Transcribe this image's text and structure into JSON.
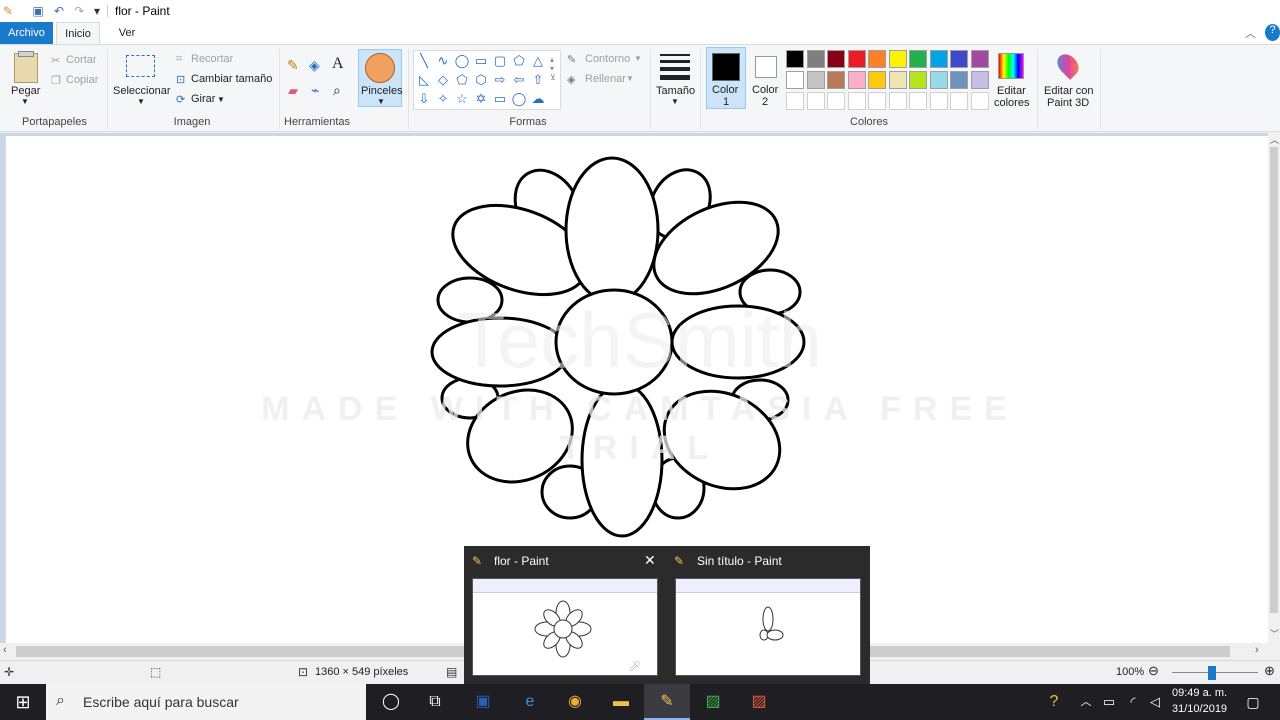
{
  "window": {
    "title": "flor - Paint"
  },
  "quick_access": {
    "icons": [
      "paint-app-icon",
      "save-icon",
      "undo-icon",
      "redo-icon",
      "customize-icon"
    ]
  },
  "tabs": {
    "file": "Archivo",
    "home": "Inicio",
    "view": "Ver"
  },
  "ribbon": {
    "clipboard": {
      "paste": "Pegar",
      "cut": "Cortar",
      "copy": "Copiar",
      "group": "Portapapeles"
    },
    "image": {
      "select": "Seleccionar",
      "crop": "Recortar",
      "resize": "Cambiar tamaño",
      "rotate": "Girar",
      "group": "Imagen"
    },
    "tools": {
      "group": "Herramientas"
    },
    "brushes": {
      "label": "Pinceles"
    },
    "shapes": {
      "outline": "Contorno",
      "fill": "Rellenar",
      "group": "Formas"
    },
    "size": {
      "label": "Tamaño"
    },
    "colors": {
      "color1": "Color",
      "color1_num": "1",
      "color2": "Color",
      "color2_num": "2",
      "edit": "Editar",
      "edit2": "colores",
      "paint3d": "Editar con",
      "paint3d2": "Paint 3D",
      "group": "Colores",
      "palette_row1": [
        "#000000",
        "#7f7f7f",
        "#880015",
        "#ed1c24",
        "#ff7f27",
        "#fff200",
        "#22b14c",
        "#00a2e8",
        "#3f48cc",
        "#a349a4"
      ],
      "palette_row2": [
        "#ffffff",
        "#c3c3c3",
        "#b97a57",
        "#ffaec9",
        "#ffc90e",
        "#efe4b0",
        "#b5e61d",
        "#99d9ea",
        "#7092be",
        "#c8bfe7"
      ]
    }
  },
  "watermark": {
    "logo": "TechSmith",
    "line": "MADE WITH CAMTASIA FREE TRIAL"
  },
  "status": {
    "dimensions": "1360 × 549 píxeles",
    "zoom": "100%"
  },
  "thumbnails": [
    {
      "title": "flor - Paint"
    },
    {
      "title": "Sin título - Paint"
    }
  ],
  "taskbar": {
    "search_placeholder": "Escribe aquí para buscar",
    "time": "09:49 a. m.",
    "date": "31/10/2019"
  }
}
